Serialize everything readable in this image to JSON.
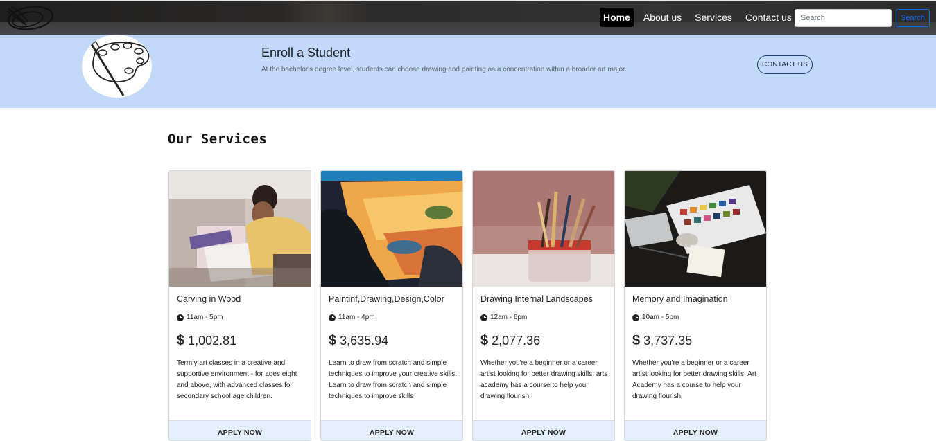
{
  "nav": {
    "logo_icon": "brush-logo-icon",
    "links": [
      {
        "label": "Home",
        "active": true
      },
      {
        "label": "About us",
        "active": false
      },
      {
        "label": "Services",
        "active": false
      },
      {
        "label": "Contact us",
        "active": false
      }
    ],
    "search_placeholder": "Search",
    "search_button": "Search"
  },
  "hero": {
    "avatar_icon": "paint-palette-icon",
    "title": "Enroll a Student",
    "text": "At the bachelor's degree level, students can choose drawing and painting as a concentration within a broader art major.",
    "contact_button": "CONTACT US",
    "background_color": "#c2d9fa"
  },
  "services": {
    "title": "Our Services",
    "cards": [
      {
        "title": "Carving in Wood",
        "time": "11am - 5pm",
        "currency": "$",
        "price": "1,002.81",
        "description": "Termly art classes in a creative and supportive environment - for ages eight and above, with advanced classes for secondary school age children.",
        "button": "APPLY NOW"
      },
      {
        "title": "Paintinf,Drawing,Design,Color",
        "time": "11am - 4pm",
        "currency": "$",
        "price": "3,635.94",
        "description": "Learn to draw from scratch and simple techniques to improve your creative skills. Learn to draw from scratch and simple techniques to improve skills",
        "button": "APPLY NOW"
      },
      {
        "title": "Drawing Internal Landscapes",
        "time": "12am - 6pm",
        "currency": "$",
        "price": "2,077.36",
        "description": "Whether you're a beginner or a career artist looking for better drawing skills, arts academy has a course to help your drawing flourish.",
        "button": "APPLY NOW"
      },
      {
        "title": "Memory and Imagination",
        "time": "10am - 5pm",
        "currency": "$",
        "price": "3,737.35",
        "description": "Whether you're a beginner or a career artist looking for better drawing skills, Art Academy has a course to help your drawing flourish.",
        "button": "APPLY NOW"
      }
    ]
  }
}
